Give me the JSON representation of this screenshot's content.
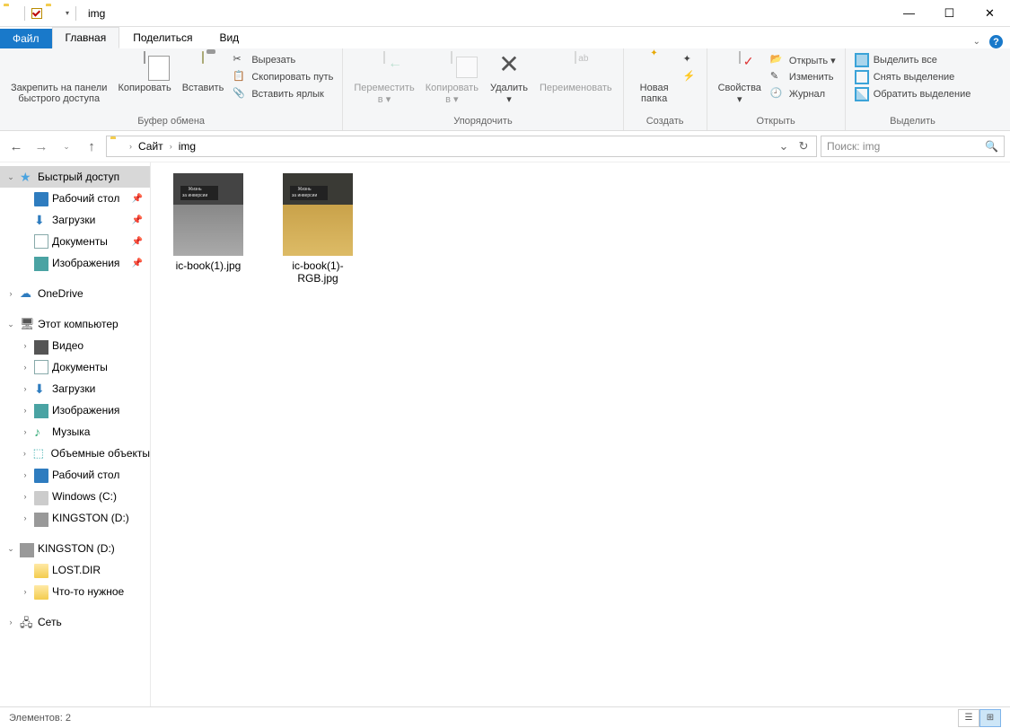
{
  "window": {
    "title": "img"
  },
  "tabs": {
    "file": "Файл",
    "home": "Главная",
    "share": "Поделиться",
    "view": "Вид"
  },
  "ribbon": {
    "pin": "Закрепить на панели\nбыстрого доступа",
    "copy": "Копировать",
    "paste": "Вставить",
    "cut": "Вырезать",
    "copypath": "Скопировать путь",
    "pastelink": "Вставить ярлык",
    "g_clipboard": "Буфер обмена",
    "moveto": "Переместить\nв ▾",
    "copyto": "Копировать\nв ▾",
    "delete": "Удалить\n▾",
    "rename": "Переименовать",
    "g_organize": "Упорядочить",
    "newfolder": "Новая\nпапка",
    "g_create": "Создать",
    "properties": "Свойства\n▾",
    "open": "Открыть ▾",
    "edit": "Изменить",
    "history": "Журнал",
    "g_open": "Открыть",
    "selall": "Выделить все",
    "selnone": "Снять выделение",
    "selinv": "Обратить выделение",
    "g_select": "Выделить"
  },
  "address": {
    "seg1": "Сайт",
    "seg2": "img"
  },
  "search": {
    "placeholder": "Поиск: img"
  },
  "nav": {
    "quick": "Быстрый доступ",
    "desktop": "Рабочий стол",
    "downloads": "Загрузки",
    "documents": "Документы",
    "pictures": "Изображения",
    "onedrive": "OneDrive",
    "thispc": "Этот компьютер",
    "video": "Видео",
    "docs2": "Документы",
    "down2": "Загрузки",
    "pics2": "Изображения",
    "music": "Музыка",
    "objects3d": "Объемные объекты",
    "desk2": "Рабочий стол",
    "cdisk": "Windows (C:)",
    "ddisk": "KINGSTON (D:)",
    "ddisk2": "KINGSTON (D:)",
    "lostdir": "LOST.DIR",
    "smth": "Что-то нужное",
    "network": "Сеть"
  },
  "files": {
    "f1": "ic-book(1).jpg",
    "f2": "ic-book(1)-RGB.jpg"
  },
  "status": {
    "text": "Элементов: 2"
  }
}
